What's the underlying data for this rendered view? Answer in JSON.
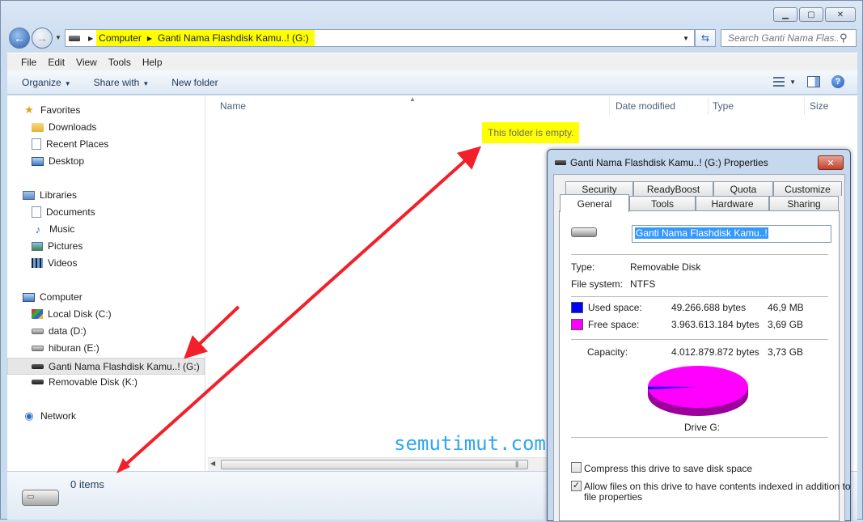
{
  "window": {
    "caption": {
      "minimize": "▁",
      "maximize": "▢",
      "close": "✕"
    }
  },
  "address": {
    "crumbs": [
      "Computer",
      "Ganti Nama Flashdisk Kamu..! (G:)"
    ],
    "search_placeholder": "Search Ganti Nama Flas..."
  },
  "menu": [
    "File",
    "Edit",
    "View",
    "Tools",
    "Help"
  ],
  "commands": {
    "organize": "Organize",
    "share_with": "Share with",
    "new_folder": "New folder"
  },
  "nav": {
    "favorites": {
      "label": "Favorites",
      "items": [
        "Downloads",
        "Recent Places",
        "Desktop"
      ]
    },
    "libraries": {
      "label": "Libraries",
      "items": [
        "Documents",
        "Music",
        "Pictures",
        "Videos"
      ]
    },
    "computer": {
      "label": "Computer",
      "items": [
        "Local Disk (C:)",
        "data (D:)",
        "hiburan (E:)",
        "Ganti Nama Flashdisk Kamu..! (G:)",
        "Removable Disk (K:)"
      ],
      "selected": "Ganti Nama Flashdisk Kamu..! (G:)"
    },
    "network": {
      "label": "Network"
    }
  },
  "columns": [
    "Name",
    "Date modified",
    "Type",
    "Size"
  ],
  "empty_message": "This folder is empty.",
  "watermark": "semutimut.com",
  "status": {
    "items": "0 items"
  },
  "properties": {
    "title": "Ganti Nama Flashdisk Kamu..! (G:) Properties",
    "tabs_top": [
      "Security",
      "ReadyBoost",
      "Quota",
      "Customize"
    ],
    "tabs_bottom": [
      "General",
      "Tools",
      "Hardware",
      "Sharing"
    ],
    "active_tab": "General",
    "name_value": "Ganti Nama Flashdisk Kamu..!",
    "type_label": "Type:",
    "type_value": "Removable Disk",
    "fs_label": "File system:",
    "fs_value": "NTFS",
    "used_label": "Used space:",
    "used_bytes": "49.266.688 bytes",
    "used_size": "46,9 MB",
    "free_label": "Free space:",
    "free_bytes": "3.963.613.184 bytes",
    "free_size": "3,69 GB",
    "capacity_label": "Capacity:",
    "capacity_bytes": "4.012.879.872 bytes",
    "capacity_size": "3,73 GB",
    "drive_label": "Drive G:",
    "compress_label": "Compress this drive to save disk space",
    "compress_checked": false,
    "index_label_1": "Allow files on this drive to have contents indexed in addition to",
    "index_label_2": "file properties",
    "index_checked": true,
    "colors": {
      "used": "#0000ff",
      "free": "#ff00ff"
    },
    "used_fraction": 0.0123
  }
}
